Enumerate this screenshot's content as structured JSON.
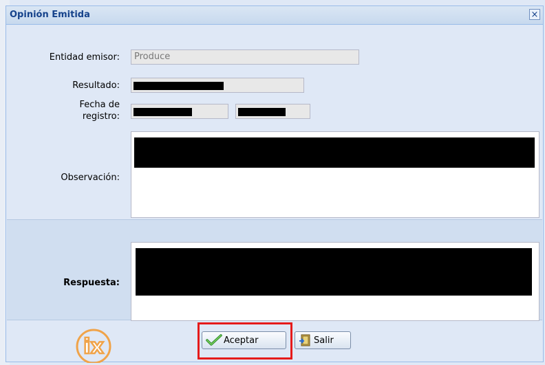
{
  "dialog": {
    "title": "Opinión Emitida",
    "close_glyph": "×"
  },
  "form": {
    "entidad_label": "Entidad emisor:",
    "entidad_value": "Produce",
    "resultado_label": "Resultado:",
    "fecha_label_line1": "Fecha de",
    "fecha_label_line2": "registro:",
    "observacion_label": "Observación:",
    "respuesta_label": "Respuesta:"
  },
  "buttons": {
    "accept_label": "Aceptar",
    "exit_label": "Salir"
  },
  "logo": {
    "text": "ix",
    "color": "#f0a349"
  },
  "colors": {
    "title_text": "#15428b",
    "highlight": "#e51a1a"
  }
}
